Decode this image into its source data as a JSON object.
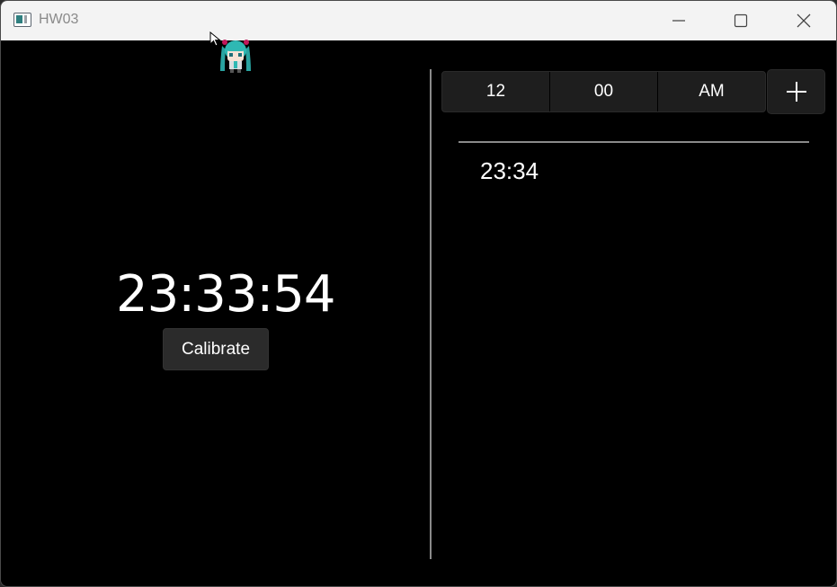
{
  "window": {
    "title": "HW03",
    "icons": {
      "app": "app-window-icon",
      "minimize": "minimize-icon",
      "maximize": "maximize-icon",
      "close": "close-icon"
    }
  },
  "overlay": {
    "cursor": "cursor-arrow-icon",
    "mascot": "anime-character-icon"
  },
  "clock": {
    "time": "23:33:54",
    "calibrate_label": "Calibrate"
  },
  "alarm_editor": {
    "hour": "12",
    "minute": "00",
    "period": "AM",
    "add_icon": "plus-icon"
  },
  "alarms": [
    {
      "time": "23:34"
    }
  ],
  "colors": {
    "background": "#000000",
    "titlebar": "#f3f3f3",
    "control_bg": "#1e1e1e",
    "button_bg": "#2b2b2b",
    "divider": "#8a8a8a",
    "text": "#ffffff"
  }
}
